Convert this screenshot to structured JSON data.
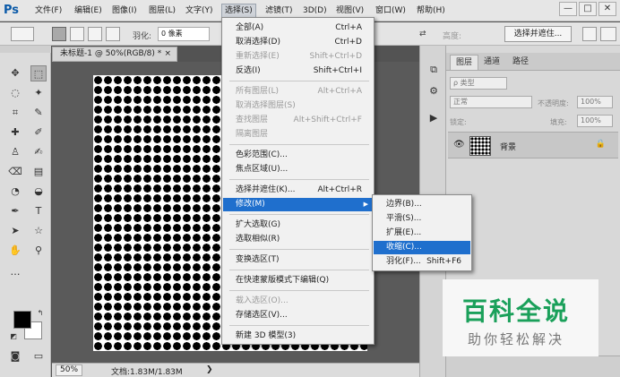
{
  "app": {
    "logo": "Ps"
  },
  "menubar": {
    "items": [
      {
        "label": "文件(F)"
      },
      {
        "label": "编辑(E)"
      },
      {
        "label": "图像(I)"
      },
      {
        "label": "图层(L)"
      },
      {
        "label": "文字(Y)"
      },
      {
        "label": "选择(S)"
      },
      {
        "label": "滤镜(T)"
      },
      {
        "label": "3D(D)"
      },
      {
        "label": "视图(V)"
      },
      {
        "label": "窗口(W)"
      },
      {
        "label": "帮助(H)"
      }
    ],
    "window_buttons": {
      "minimize": "—",
      "maximize": "□",
      "close": "✕"
    }
  },
  "options": {
    "feather_label": "羽化:",
    "feather_value": "0 像素",
    "height_label": "高度:",
    "refine_button": "选择并遮住..."
  },
  "document": {
    "tab_title": "未标题-1 @ 50%(RGB/8) *",
    "tab_close": "×",
    "zoom": "50%",
    "info": "文档:1.83M/1.83M",
    "info_arrow": "❯"
  },
  "select_menu": {
    "items": [
      {
        "label": "全部(A)",
        "shortcut": "Ctrl+A",
        "disabled": false
      },
      {
        "label": "取消选择(D)",
        "shortcut": "Ctrl+D",
        "disabled": false
      },
      {
        "label": "重新选择(E)",
        "shortcut": "Shift+Ctrl+D",
        "disabled": true
      },
      {
        "label": "反选(I)",
        "shortcut": "Shift+Ctrl+I",
        "disabled": false
      },
      {
        "label": "所有图层(L)",
        "shortcut": "Alt+Ctrl+A",
        "disabled": true
      },
      {
        "label": "取消选择图层(S)",
        "shortcut": "",
        "disabled": true
      },
      {
        "label": "查找图层",
        "shortcut": "Alt+Shift+Ctrl+F",
        "disabled": true
      },
      {
        "label": "隔离图层",
        "shortcut": "",
        "disabled": true
      },
      {
        "label": "色彩范围(C)...",
        "shortcut": "",
        "disabled": false
      },
      {
        "label": "焦点区域(U)...",
        "shortcut": "",
        "disabled": false
      },
      {
        "label": "选择并遮住(K)...",
        "shortcut": "Alt+Ctrl+R",
        "disabled": false
      },
      {
        "label": "修改(M)",
        "shortcut": "",
        "disabled": false
      },
      {
        "label": "扩大选取(G)",
        "shortcut": "",
        "disabled": false
      },
      {
        "label": "选取相似(R)",
        "shortcut": "",
        "disabled": false
      },
      {
        "label": "变换选区(T)",
        "shortcut": "",
        "disabled": false
      },
      {
        "label": "在快速蒙版模式下编辑(Q)",
        "shortcut": "",
        "disabled": false
      },
      {
        "label": "载入选区(O)...",
        "shortcut": "",
        "disabled": true
      },
      {
        "label": "存储选区(V)...",
        "shortcut": "",
        "disabled": false
      },
      {
        "label": "新建 3D 模型(3)",
        "shortcut": "",
        "disabled": false
      }
    ],
    "submenu_arrow": "▶"
  },
  "modify_submenu": {
    "items": [
      {
        "label": "边界(B)...",
        "shortcut": ""
      },
      {
        "label": "平滑(S)...",
        "shortcut": ""
      },
      {
        "label": "扩展(E)...",
        "shortcut": ""
      },
      {
        "label": "收缩(C)...",
        "shortcut": ""
      },
      {
        "label": "羽化(F)...",
        "shortcut": "Shift+F6"
      }
    ]
  },
  "layers_panel": {
    "tabs": [
      {
        "label": "图层"
      },
      {
        "label": "通道"
      },
      {
        "label": "路径"
      }
    ],
    "filter_label": "ρ 类型",
    "blend_mode": "正常",
    "opacity_label": "不透明度:",
    "opacity_value": "100%",
    "lock_label": "锁定:",
    "fill_label": "填充:",
    "fill_value": "100%",
    "layer_name": "背景"
  },
  "watermark": {
    "title": "百科全说",
    "subtitle": "助你轻松解决"
  },
  "colors": {
    "menu_highlight": "#1f6fcd",
    "watermark_green": "#1aa05a"
  }
}
